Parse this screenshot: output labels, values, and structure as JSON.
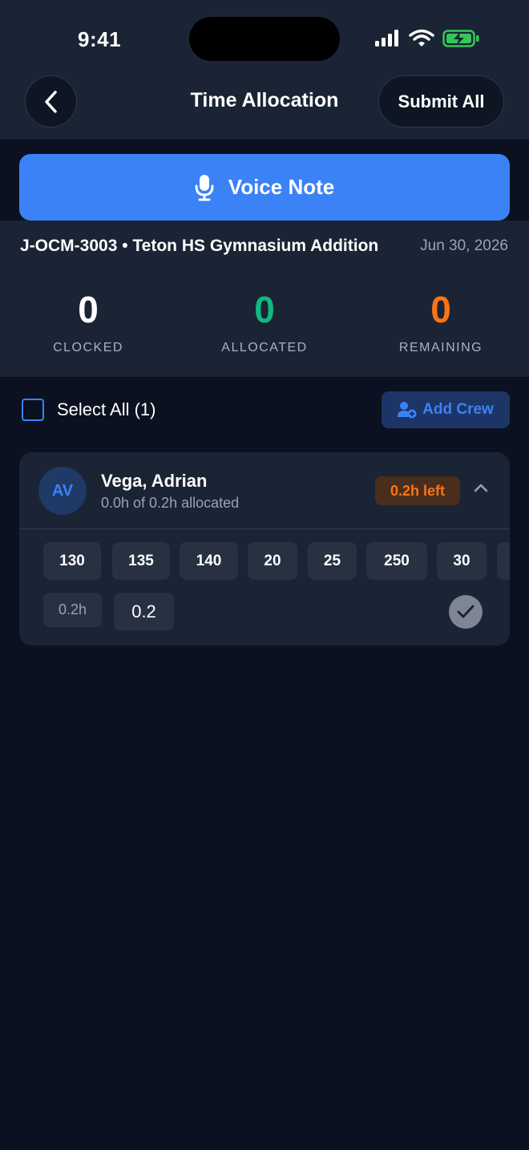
{
  "status_bar": {
    "time": "9:41"
  },
  "header": {
    "title": "Time Allocation",
    "submit_label": "Submit All"
  },
  "voice_note": {
    "label": "Voice Note"
  },
  "job": {
    "summary": "J-OCM-3003 • Teton HS Gymnasium Addition",
    "date": "Jun 30, 2026"
  },
  "stats": {
    "clocked": {
      "value": "0",
      "label": "CLOCKED",
      "color": "#ffffff"
    },
    "allocated": {
      "value": "0",
      "label": "ALLOCATED",
      "color": "#10b981"
    },
    "remaining": {
      "value": "0",
      "label": "REMAINING",
      "color": "#f97316"
    }
  },
  "select_all": {
    "label": "Select All (1)",
    "checked": false
  },
  "add_crew": {
    "label": "Add Crew"
  },
  "crew": [
    {
      "initials": "AV",
      "name": "Vega, Adrian",
      "allocated_text": "0.0h of 0.2h allocated",
      "left_badge": "0.2h left",
      "expanded": true,
      "cost_codes": [
        "130",
        "135",
        "140",
        "20",
        "25",
        "250",
        "30",
        ""
      ],
      "hours_tag": "0.2h",
      "hours_value": "0.2"
    }
  ],
  "colors": {
    "accent": "#3b82f6",
    "allocated": "#10b981",
    "remaining": "#f97316"
  },
  "icons": [
    "chevron-left-icon",
    "microphone-icon",
    "add-user-icon",
    "chevron-up-icon",
    "check-icon",
    "signal-icon",
    "wifi-icon",
    "battery-charging-icon"
  ]
}
